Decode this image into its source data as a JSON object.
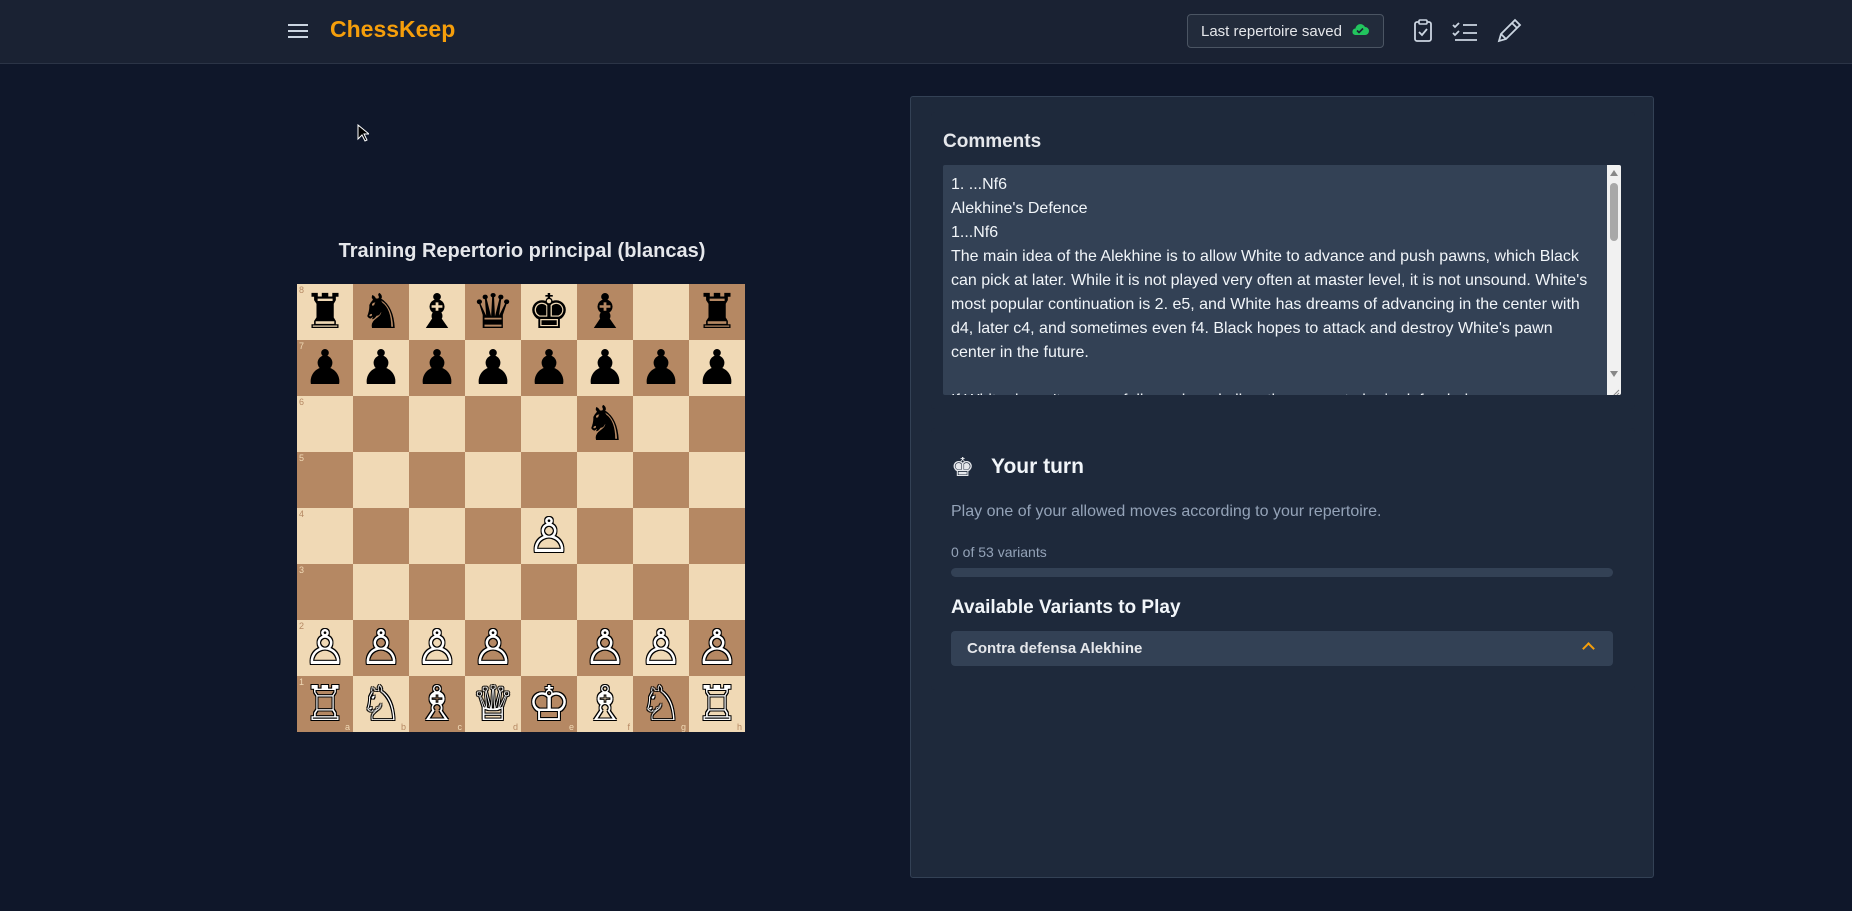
{
  "header": {
    "app_name": "ChessKeep",
    "save_status": "Last repertoire saved",
    "icons": [
      "menu-icon",
      "cloud-check-icon",
      "clipboard-check-icon",
      "checklist-icon",
      "pencil-icon"
    ]
  },
  "board": {
    "title": "Training Repertorio principal (blancas)",
    "ranks": [
      [
        "♜",
        "♞",
        "♝",
        "♛",
        "♚",
        "♝",
        "",
        "♜"
      ],
      [
        "♟",
        "♟",
        "♟",
        "♟",
        "♟",
        "♟",
        "♟",
        "♟"
      ],
      [
        "",
        "",
        "",
        "",
        "",
        "♞",
        "",
        ""
      ],
      [
        "",
        "",
        "",
        "",
        "",
        "",
        "",
        ""
      ],
      [
        "",
        "",
        "",
        "",
        "♙",
        "",
        "",
        ""
      ],
      [
        "",
        "",
        "",
        "",
        "",
        "",
        "",
        ""
      ],
      [
        "♙",
        "♙",
        "♙",
        "♙",
        "",
        "♙",
        "♙",
        "♙"
      ],
      [
        "♖",
        "♘",
        "♗",
        "♕",
        "♔",
        "♗",
        "♘",
        "♖"
      ]
    ],
    "rank_labels": [
      "8",
      "7",
      "6",
      "5",
      "4",
      "3",
      "2",
      "1"
    ],
    "file_labels": [
      "a",
      "b",
      "c",
      "d",
      "e",
      "f",
      "g",
      "h"
    ],
    "colors": {
      "light": "#f0d9b5",
      "dark": "#b58863"
    }
  },
  "comments": {
    "title": "Comments",
    "text": "1. ...Nf6\nAlekhine's Defence\n1...Nf6\nThe main idea of the Alekhine is to allow White to advance and push pawns, which Black can pick at later. While it is not played very often at master level, it is not unsound. White's most popular continuation is 2. e5, and White has dreams of advancing in the center with d4, later c4, and sometimes even f4. Black hopes to attack and destroy White's pawn center in the future.\n\nIf White doesn't successfully push and allow the pawns to be in defended ..."
  },
  "turn": {
    "icon": "chess-king-icon",
    "title": "Your turn",
    "description": "Play one of your allowed moves according to your repertoire.",
    "progress_label": "0 of 53 variants",
    "progress_value": 0
  },
  "variants": {
    "title": "Available Variants to Play",
    "items": [
      {
        "label": "Contra defensa Alekhine"
      }
    ]
  },
  "theme": {
    "accent": "#f59e0b",
    "background": "#0f172a",
    "panel": "#1e293b"
  }
}
